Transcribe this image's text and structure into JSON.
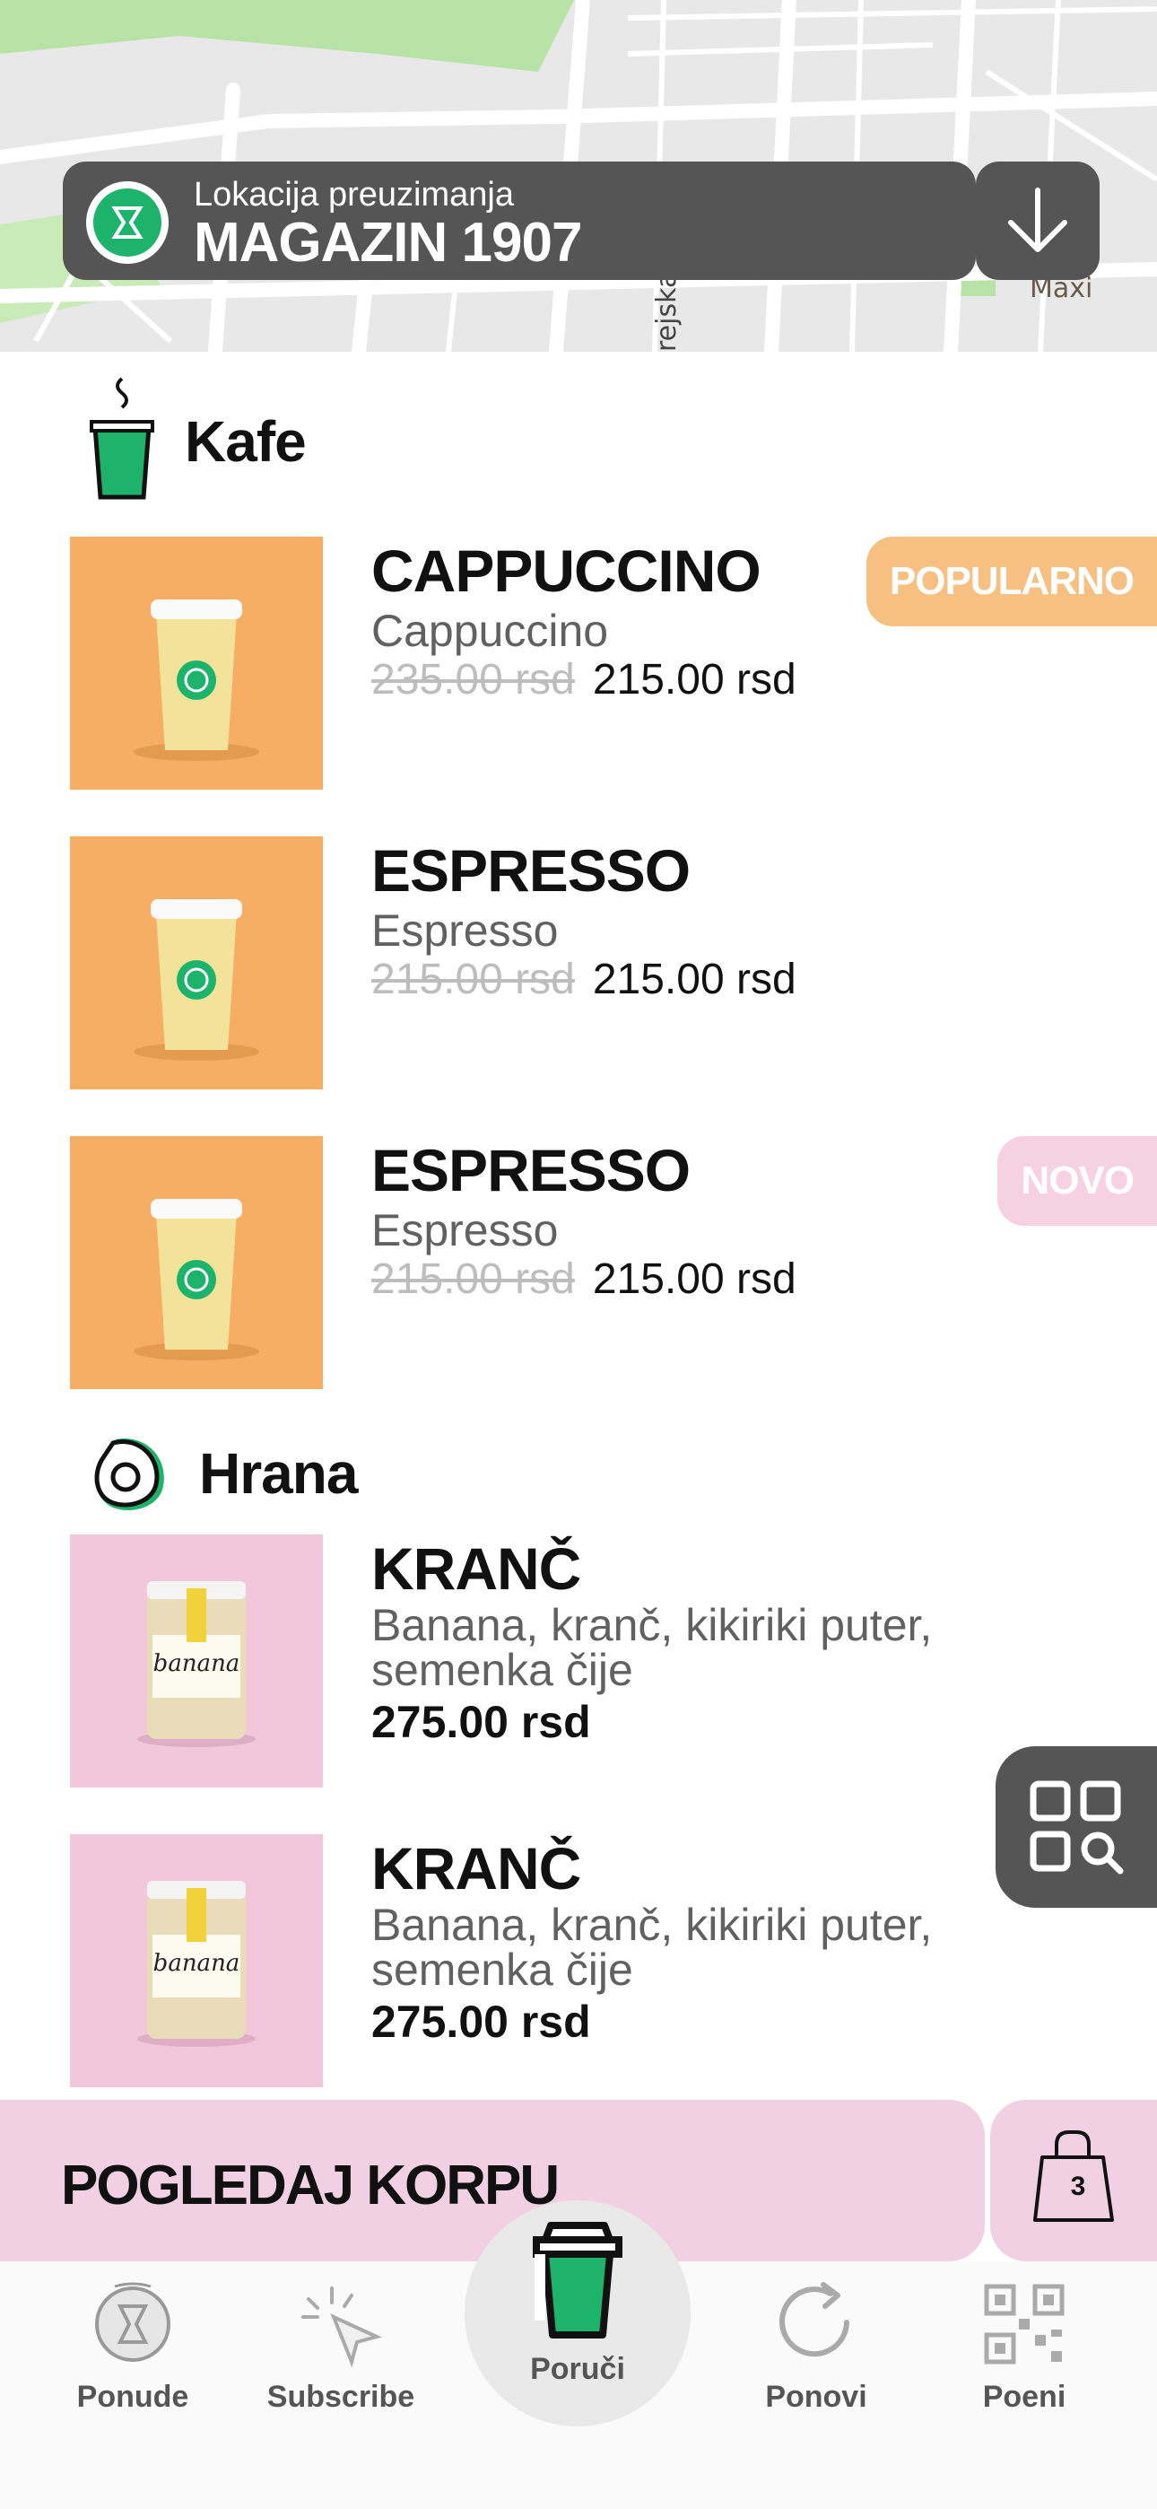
{
  "map": {
    "labels": [
      "Maxi",
      "rejska"
    ]
  },
  "location": {
    "caption": "Lokacija preuzimanja",
    "name": "MAGAZIN 1907"
  },
  "sections": [
    {
      "title": "Kafe",
      "icon": "coffee-cup-icon",
      "products": [
        {
          "name": "CAPPUCCINO",
          "desc": "Cappuccino",
          "old_price": "235.00 rsd",
          "price": "215.00 rsd",
          "badge": "POPULARNO"
        },
        {
          "name": "ESPRESSO",
          "desc": "Espresso",
          "old_price": "215.00 rsd",
          "price": "215.00 rsd"
        },
        {
          "name": "ESPRESSO",
          "desc": "Espresso",
          "old_price": "215.00 rsd",
          "price": "215.00 rsd",
          "badge": "NOVO"
        }
      ]
    },
    {
      "title": "Hrana",
      "icon": "avocado-icon",
      "products": [
        {
          "name": "KRANČ",
          "desc": "Banana, kranč, kikiriki puter, semenka čije",
          "price": "275.00 rsd"
        },
        {
          "name": "KRANČ",
          "desc": "Banana, kranč, kikiriki puter, semenka čije",
          "price": "275.00 rsd"
        }
      ]
    }
  ],
  "cart": {
    "label": "POGLEDAJ KORPU",
    "count": "3"
  },
  "nav": [
    {
      "label": "Ponude",
      "icon": "offers-icon"
    },
    {
      "label": "Subscribe",
      "icon": "cursor-click-icon"
    },
    {
      "label": "Poruči",
      "icon": "coffee-cup-icon",
      "active": true
    },
    {
      "label": "Ponovi",
      "icon": "repeat-icon"
    },
    {
      "label": "Poeni",
      "icon": "qr-code-icon"
    }
  ],
  "colors": {
    "accent_green": "#1db36b",
    "dark_gray": "#555556",
    "pink": "#f0d0e2",
    "popular_badge": "#f6c083",
    "new_badge": "#f6d1e2"
  }
}
